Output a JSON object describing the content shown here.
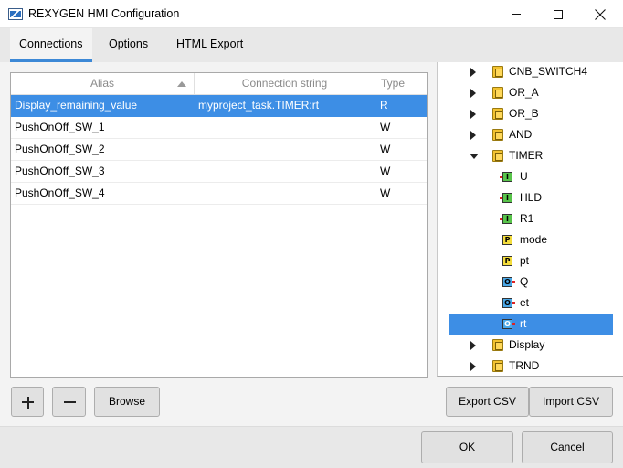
{
  "window": {
    "title": "REXYGEN HMI Configuration"
  },
  "tabs": [
    {
      "label": "Connections",
      "active": true
    },
    {
      "label": "Options",
      "active": false
    },
    {
      "label": "HTML Export",
      "active": false
    }
  ],
  "table": {
    "columns": {
      "alias": "Alias",
      "connection": "Connection string",
      "type": "Type"
    },
    "sort": {
      "column": "alias",
      "direction": "ascending"
    },
    "rows": [
      {
        "alias": "Display_remaining_value",
        "connection": "myproject_task.TIMER:rt",
        "type": "R",
        "selected": true
      },
      {
        "alias": "PushOnOff_SW_1",
        "connection": "",
        "type": "W",
        "selected": false
      },
      {
        "alias": "PushOnOff_SW_2",
        "connection": "",
        "type": "W",
        "selected": false
      },
      {
        "alias": "PushOnOff_SW_3",
        "connection": "",
        "type": "W",
        "selected": false
      },
      {
        "alias": "PushOnOff_SW_4",
        "connection": "",
        "type": "W",
        "selected": false
      }
    ]
  },
  "tree": {
    "items": [
      {
        "label": "CNB_SWITCH4",
        "kind": "block",
        "state": "collapsed",
        "depth": 0
      },
      {
        "label": "OR_A",
        "kind": "block",
        "state": "collapsed",
        "depth": 0
      },
      {
        "label": "OR_B",
        "kind": "block",
        "state": "collapsed",
        "depth": 0
      },
      {
        "label": "AND",
        "kind": "block",
        "state": "collapsed",
        "depth": 0
      },
      {
        "label": "TIMER",
        "kind": "block",
        "state": "expanded",
        "depth": 0
      },
      {
        "label": "U",
        "kind": "input",
        "glyph": "I",
        "depth": 1
      },
      {
        "label": "HLD",
        "kind": "input",
        "glyph": "I",
        "depth": 1
      },
      {
        "label": "R1",
        "kind": "input",
        "glyph": "I",
        "depth": 1
      },
      {
        "label": "mode",
        "kind": "parameter",
        "glyph": "P",
        "depth": 1
      },
      {
        "label": "pt",
        "kind": "parameter",
        "glyph": "P",
        "depth": 1
      },
      {
        "label": "Q",
        "kind": "output",
        "glyph": "O",
        "depth": 1
      },
      {
        "label": "et",
        "kind": "output",
        "glyph": "O",
        "depth": 1
      },
      {
        "label": "rt",
        "kind": "output",
        "glyph": "O",
        "depth": 1,
        "selected": true
      },
      {
        "label": "Display",
        "kind": "block",
        "state": "collapsed",
        "depth": 0
      },
      {
        "label": "TRND",
        "kind": "block",
        "state": "collapsed",
        "depth": 0
      }
    ]
  },
  "buttons": {
    "browse": "Browse",
    "export_csv": "Export CSV",
    "import_csv": "Import CSV",
    "ok": "OK",
    "cancel": "Cancel"
  },
  "colors": {
    "selection": "#3d8ee5",
    "tab_indicator": "#3c88d6"
  }
}
